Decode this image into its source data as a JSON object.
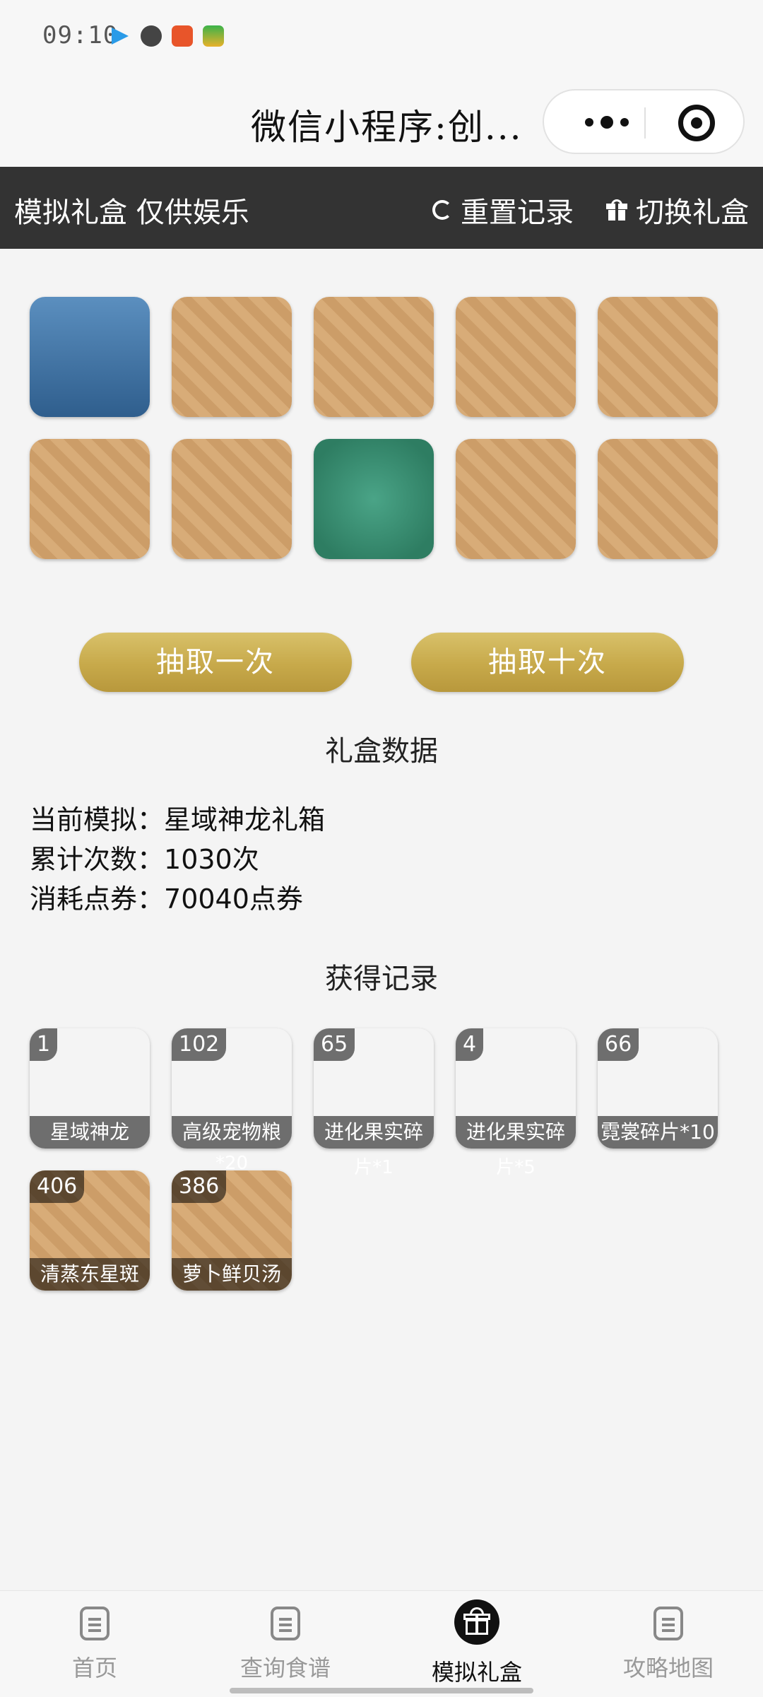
{
  "status": {
    "time": "09:10"
  },
  "titlebar": {
    "title": "微信小程序:创..."
  },
  "header": {
    "title": "模拟礼盒 仅供娱乐",
    "reset_label": "重置记录",
    "switch_label": "切换礼盒"
  },
  "draws": [
    {
      "kind": "bag"
    },
    {
      "kind": "soup"
    },
    {
      "kind": "fish"
    },
    {
      "kind": "soup"
    },
    {
      "kind": "soup"
    },
    {
      "kind": "soup"
    },
    {
      "kind": "fish"
    },
    {
      "kind": "fruit"
    },
    {
      "kind": "soup"
    },
    {
      "kind": "fish"
    }
  ],
  "buttons": {
    "once": "抽取一次",
    "ten": "抽取十次"
  },
  "data_section": {
    "title": "礼盒数据",
    "current_label": "当前模拟：",
    "current_value": "星域神龙礼箱",
    "count_label": "累计次数：",
    "count_value": "1030次",
    "cost_label": "消耗点券：",
    "cost_value": "70040点券"
  },
  "records_section": {
    "title": "获得记录",
    "items": [
      {
        "count": "1",
        "label": "星域神龙",
        "overflow": ""
      },
      {
        "count": "102",
        "label": "高级宠物粮",
        "overflow": "*20"
      },
      {
        "count": "65",
        "label": "进化果实碎",
        "overflow": "片*1"
      },
      {
        "count": "4",
        "label": "进化果实碎",
        "overflow": "片*5"
      },
      {
        "count": "66",
        "label": "霓裳碎片*10",
        "overflow": ""
      },
      {
        "count": "406",
        "label": "清蒸东星斑",
        "overflow": ""
      },
      {
        "count": "386",
        "label": "萝卜鲜贝汤",
        "overflow": ""
      }
    ]
  },
  "tabs": {
    "home": "首页",
    "recipes": "查询食谱",
    "giftbox": "模拟礼盒",
    "map": "攻略地图"
  },
  "colors": {
    "header_bg": "#333333",
    "button_gold": "#c7a94a",
    "page_bg": "#f4f4f4"
  }
}
